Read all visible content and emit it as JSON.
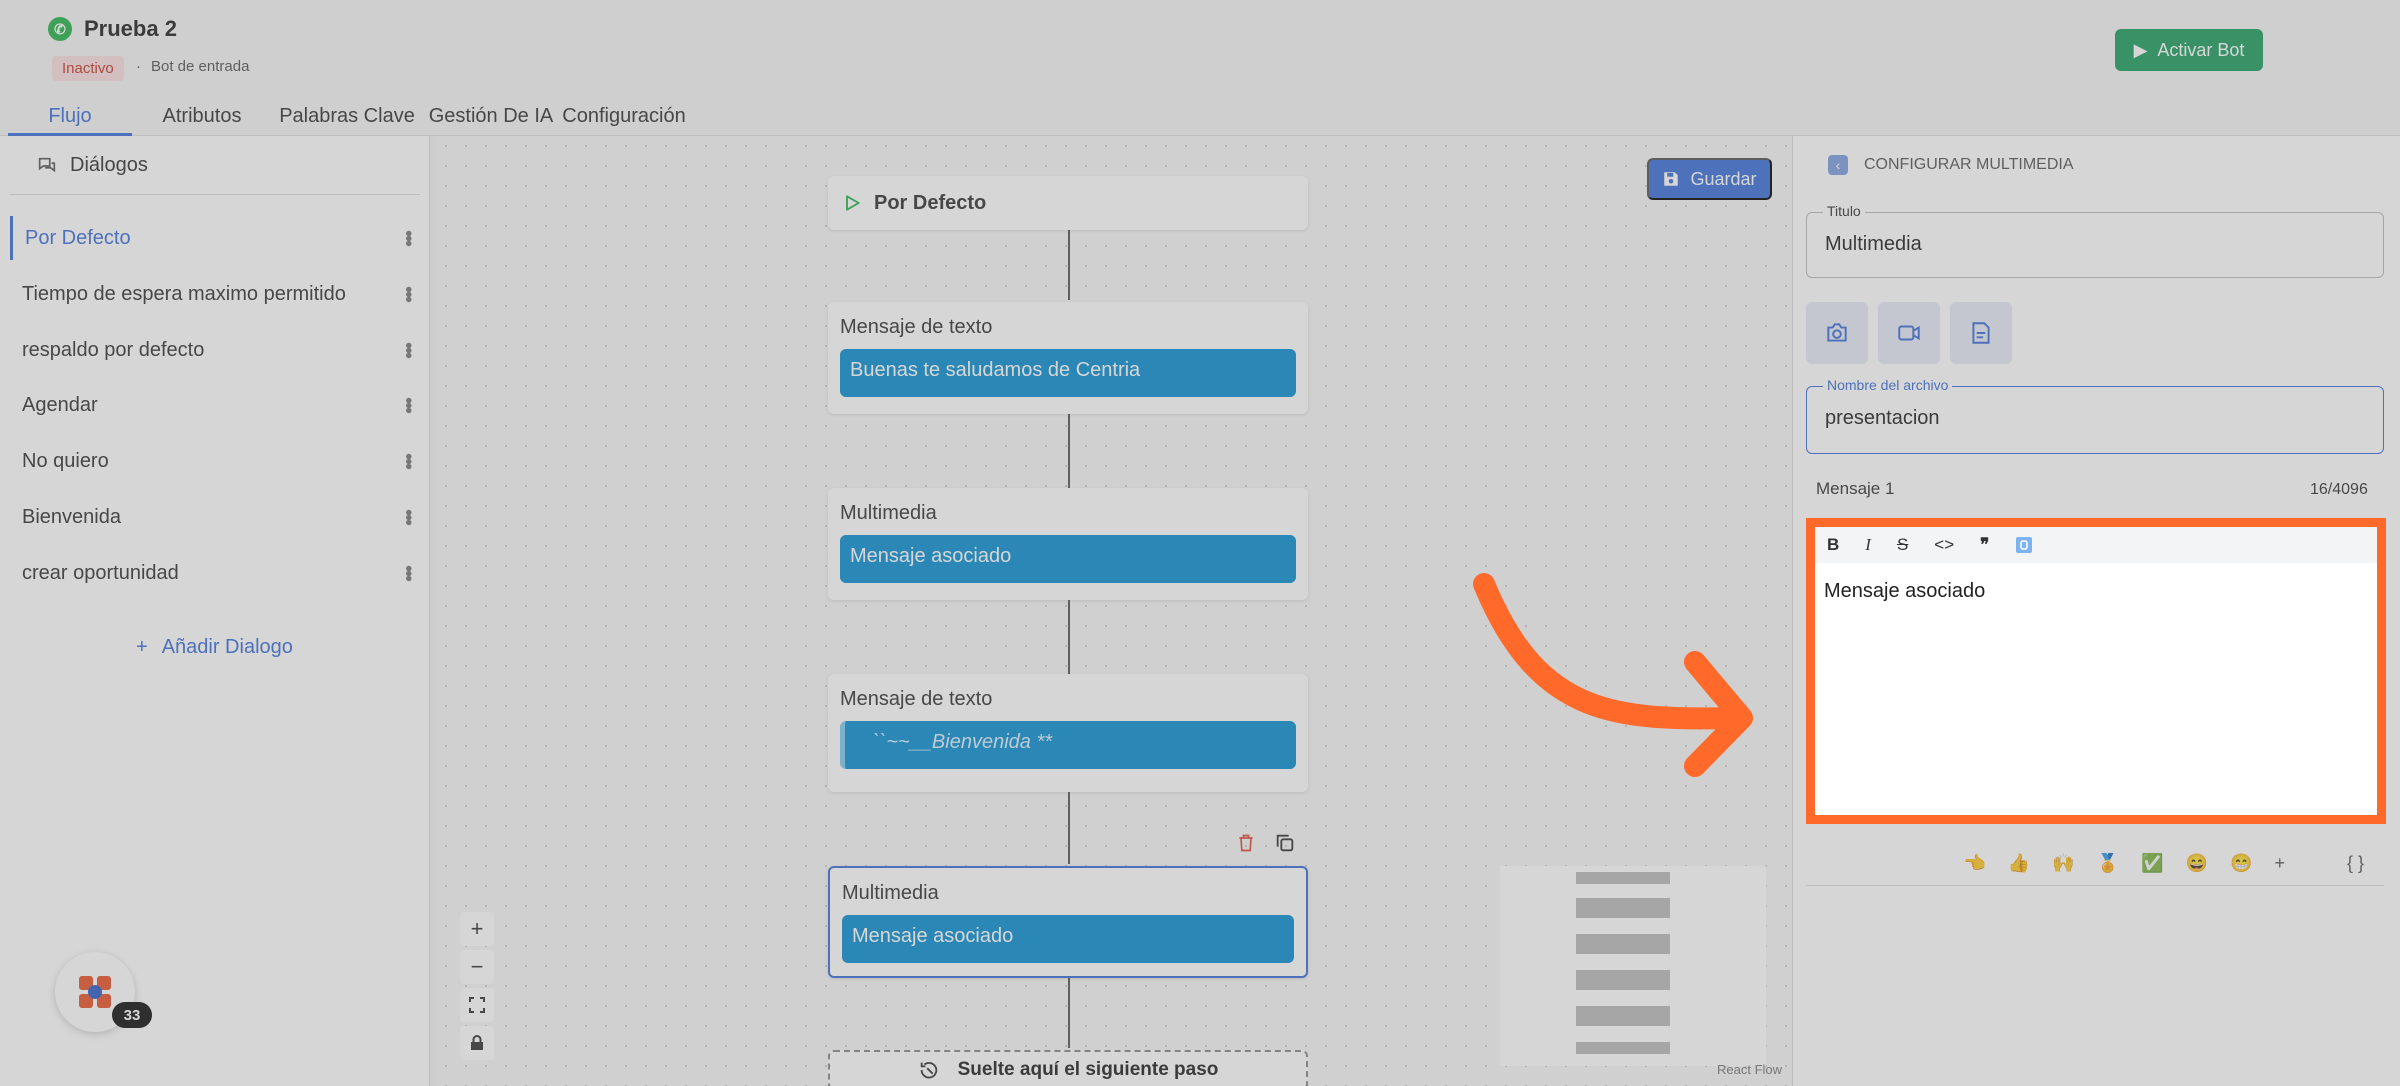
{
  "header": {
    "title": "Prueba 2",
    "status": "Inactivo",
    "separator": "·",
    "bot_type": "Bot de entrada",
    "activate_label": "Activar Bot"
  },
  "tabs": [
    {
      "label": "Flujo",
      "active": true
    },
    {
      "label": "Atributos"
    },
    {
      "label": "Palabras Clave"
    },
    {
      "label": "Gestión De IA"
    },
    {
      "label": "Configuración"
    }
  ],
  "sidebar": {
    "heading": "Diálogos",
    "items": [
      {
        "label": "Por Defecto",
        "active": true
      },
      {
        "label": "Tiempo de espera maximo permitido"
      },
      {
        "label": "respaldo por defecto"
      },
      {
        "label": "Agendar"
      },
      {
        "label": "No quiero"
      },
      {
        "label": "Bienvenida"
      },
      {
        "label": "crear oportunidad"
      }
    ],
    "add_label": "Añadir Dialogo"
  },
  "canvas": {
    "save_label": "Guardar",
    "start_node": "Por Defecto",
    "nodes": [
      {
        "type": "Mensaje de texto",
        "message": "Buenas te saludamos de Centria"
      },
      {
        "type": "Multimedia",
        "message": "Mensaje asociado"
      },
      {
        "type": "Mensaje de texto",
        "message": "``~~__Bienvenida **"
      },
      {
        "type": "Multimedia",
        "message": "Mensaje asociado"
      }
    ],
    "drop_label": "Suelte aquí el siguiente paso",
    "attribution": "React Flow",
    "notification_count": "33"
  },
  "panel": {
    "heading": "CONFIGURAR MULTIMEDIA",
    "title_legend": "Titulo",
    "title_value": "Multimedia",
    "filename_legend": "Nombre del archivo",
    "filename_value": "presentacion",
    "message_label": "Mensaje 1",
    "char_count": "16/4096",
    "toolbar": [
      "B",
      "I",
      "S",
      "<>",
      "❞"
    ],
    "editor_text": "Mensaje asociado",
    "emoji_add": "+",
    "variables_icon": "{ }"
  },
  "colors": {
    "accent": "#3b6fd8",
    "node_message": "#0a8ed1",
    "activate": "#1e9e5e",
    "highlight": "#ff6a2b"
  }
}
